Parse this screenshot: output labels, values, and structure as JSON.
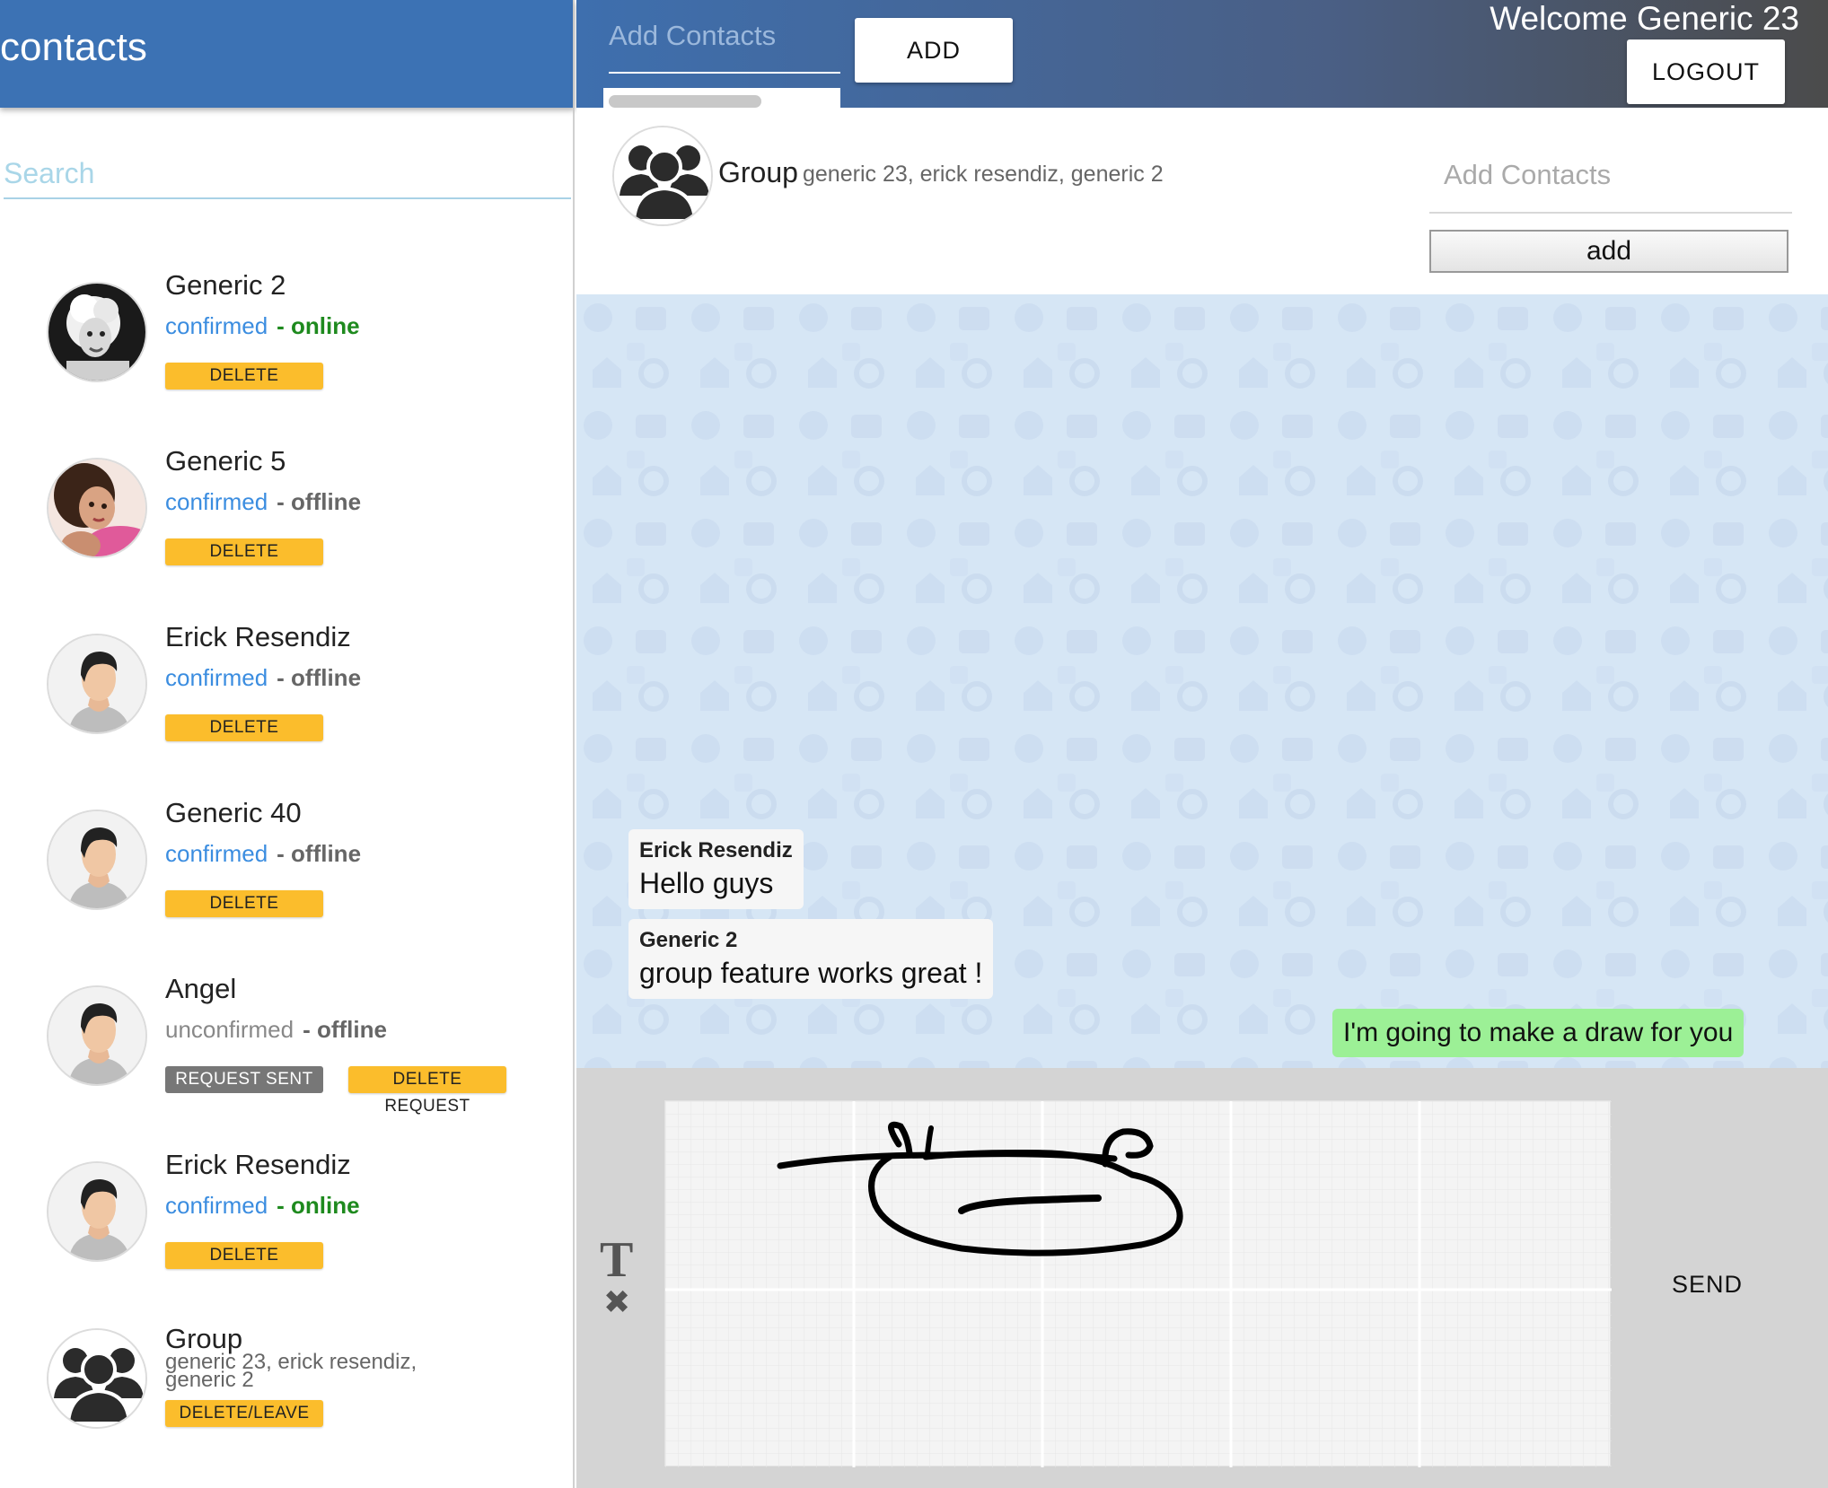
{
  "sidebar": {
    "title": "contacts",
    "search_placeholder": "Search",
    "contacts": [
      {
        "name": "Generic 2",
        "status": "confirmed",
        "presence": "- online",
        "action": "DELETE",
        "avatar": "woman-bw-photo"
      },
      {
        "name": "Generic 5",
        "status": "confirmed",
        "presence": "- offline",
        "action": "DELETE",
        "avatar": "woman-color-photo"
      },
      {
        "name": "Erick Resendiz",
        "status": "confirmed",
        "presence": "- offline",
        "action": "DELETE",
        "avatar": "default-user-icon"
      },
      {
        "name": "Generic 40",
        "status": "confirmed",
        "presence": "- offline",
        "action": "DELETE",
        "avatar": "default-user-icon"
      },
      {
        "name": "Angel",
        "status": "unconfirmed",
        "presence": "- offline",
        "action": "REQUEST SENT",
        "action2": "DELETE REQUEST",
        "avatar": "default-user-icon"
      },
      {
        "name": "Erick Resendiz",
        "status": "confirmed",
        "presence": "- online",
        "action": "DELETE",
        "avatar": "default-user-icon"
      },
      {
        "name": "Group",
        "members_line1": "generic 23, erick resendiz,",
        "members_line2": "generic 2",
        "action": "DELETE/LEAVE",
        "avatar": "group-icon"
      }
    ]
  },
  "topbar": {
    "add_contacts_placeholder": "Add Contacts",
    "add_button": "ADD",
    "welcome": "Welcome Generic 23",
    "logout_button": "LOGOUT"
  },
  "chat": {
    "title": "Group",
    "members": "generic 23, erick resendiz, generic 2",
    "add_contacts_placeholder": "Add Contacts",
    "add_button": "add",
    "messages": [
      {
        "author": "Erick Resendiz",
        "text": "Hello guys",
        "own": false
      },
      {
        "author": "Generic 2",
        "text": "group feature works great !",
        "own": false
      },
      {
        "author": "",
        "text": "I'm going to make a draw for you",
        "own": true
      }
    ]
  },
  "composer": {
    "text_mode_glyph": "T",
    "clear_glyph": "✖",
    "send_button": "SEND"
  },
  "colors": {
    "sidebar_header": "#3c72b4",
    "online": "#1e8a1e",
    "confirmed": "#3b8de0",
    "delete_button": "#fbbd2c",
    "request_sent_button": "#777777",
    "own_message": "#9cf096",
    "chat_background": "#d6e6f5",
    "composer_background": "#d4d4d4"
  }
}
